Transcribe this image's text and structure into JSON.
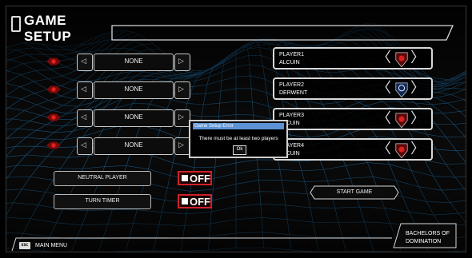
{
  "screen": {
    "title": "GAME SETUP"
  },
  "player_slots": [
    {
      "selector_value": "NONE",
      "player_label": "PLAYER1",
      "college": "ALCUIN",
      "emblem": "red-shield-emblem"
    },
    {
      "selector_value": "NONE",
      "player_label": "PLAYER2",
      "college": "DERWENT",
      "emblem": "blue-shield-emblem"
    },
    {
      "selector_value": "NONE",
      "player_label": "PLAYER3",
      "college": "ALCUIN",
      "emblem": "red-shield-emblem"
    },
    {
      "selector_value": "NONE",
      "player_label": "PLAYER4",
      "college": "ALCUIN",
      "emblem": "red-shield-emblem"
    }
  ],
  "options": {
    "neutral_player_label": "NEUTRAL PLAYER",
    "neutral_player_state": "OFF",
    "turn_timer_label": "TURN TIMER",
    "turn_timer_state": "OFF"
  },
  "start_button": "START GAME",
  "brand_line1": "BACHELORS OF",
  "brand_line2": "DOMINATION",
  "footer": {
    "esc_key": "ESC",
    "main_menu": "MAIN MENU"
  },
  "dialog": {
    "title": "Game Setup Error",
    "message": "There must be at least two players",
    "ok_label": "Ok"
  },
  "colors": {
    "grid": "#1f6fa8",
    "toggle_border": "#d0202a",
    "dialog_title_bar": "#5c93d4",
    "frame_line": "#d8d8d8"
  }
}
